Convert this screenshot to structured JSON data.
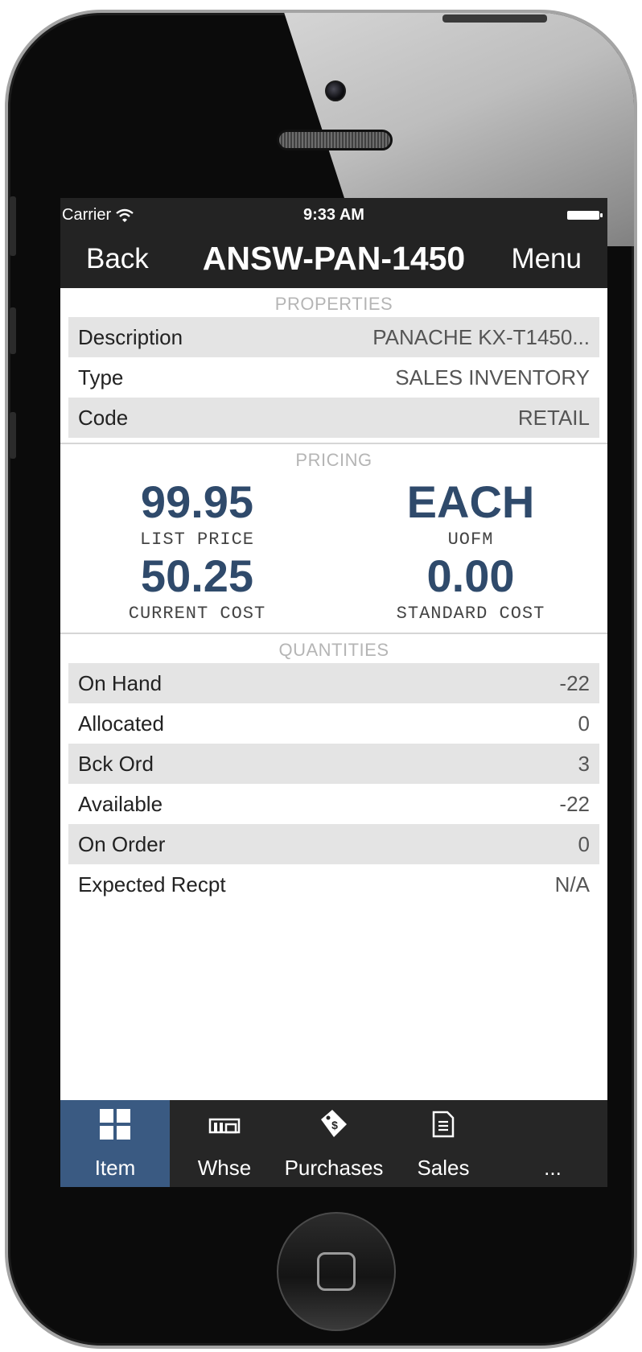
{
  "status_bar": {
    "carrier": "Carrier",
    "time": "9:33 AM"
  },
  "nav": {
    "back_label": "Back",
    "title": "ANSW-PAN-1450",
    "menu_label": "Menu"
  },
  "properties": {
    "header": "PROPERTIES",
    "rows": [
      {
        "label": "Description",
        "value": "PANACHE KX-T1450..."
      },
      {
        "label": "Type",
        "value": "SALES INVENTORY"
      },
      {
        "label": "Code",
        "value": "RETAIL"
      }
    ]
  },
  "pricing": {
    "header": "PRICING",
    "list_price": {
      "value": "99.95",
      "label": "LIST PRICE"
    },
    "uofm": {
      "value": "EACH",
      "label": "UOFM"
    },
    "current_cost": {
      "value": "50.25",
      "label": "CURRENT COST"
    },
    "standard_cost": {
      "value": "0.00",
      "label": "STANDARD COST"
    }
  },
  "quantities": {
    "header": "QUANTITIES",
    "rows": [
      {
        "label": "On Hand",
        "value": "-22"
      },
      {
        "label": "Allocated",
        "value": "0"
      },
      {
        "label": "Bck Ord",
        "value": "3"
      },
      {
        "label": "Available",
        "value": "-22"
      },
      {
        "label": "On Order",
        "value": "0"
      },
      {
        "label": "Expected Recpt",
        "value": "N/A"
      }
    ]
  },
  "tabbar": {
    "tabs": [
      {
        "label": "Item",
        "icon": "grid-icon",
        "active": true
      },
      {
        "label": "Whse",
        "icon": "warehouse-icon",
        "active": false
      },
      {
        "label": "Purchases",
        "icon": "price-tag-icon",
        "active": false
      },
      {
        "label": "Sales",
        "icon": "document-icon",
        "active": false
      },
      {
        "label": "...",
        "icon": "",
        "active": false
      }
    ]
  },
  "colors": {
    "accent": "#2f4a6b",
    "nav_bg": "#232323",
    "active_tab": "#3a5a82",
    "row_alt": "#e4e4e4"
  }
}
